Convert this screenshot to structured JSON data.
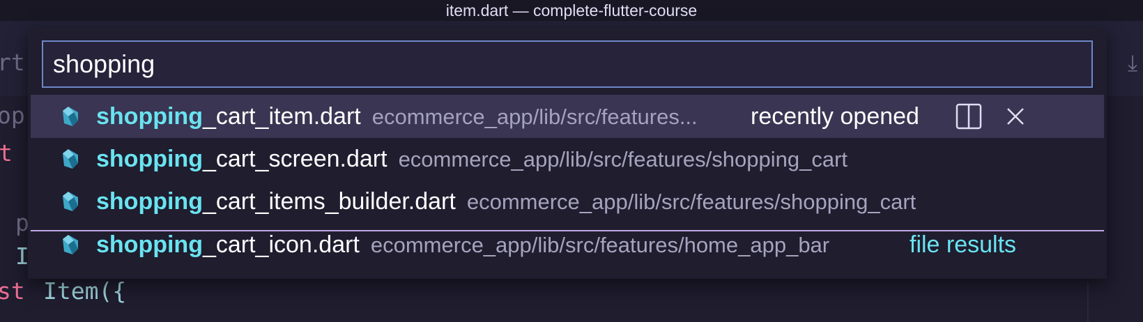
{
  "window": {
    "title": "item.dart — complete-flutter-course"
  },
  "editor_fragments": [
    "rt",
    "op",
    "t",
    "p",
    "I",
    "st",
    "Item({"
  ],
  "quick_open": {
    "search_value": "shopping",
    "rows": [
      {
        "highlight": "shopping",
        "rest": "_cart_item.dart",
        "path": "ecommerce_app/lib/src/features...",
        "tag": "recently opened"
      },
      {
        "highlight": "shopping",
        "rest": "_cart_screen.dart",
        "path": "ecommerce_app/lib/src/features/shopping_cart",
        "tag": ""
      },
      {
        "highlight": "shopping",
        "rest": "_cart_items_builder.dart",
        "path": "ecommerce_app/lib/src/features/shopping_cart",
        "tag": ""
      },
      {
        "highlight": "shopping",
        "rest": "_cart_icon.dart",
        "path": "ecommerce_app/lib/src/features/home_app_bar",
        "tag": "file results"
      }
    ],
    "icons": {
      "file_type": "dart-file-icon",
      "split": "split-editor-icon",
      "remove": "close-icon"
    }
  },
  "colors": {
    "accent_match": "#6ae3f0",
    "selected_row": "#393552",
    "focus_border": "#6f87c7",
    "separator": "#c4a7e7",
    "background": "#1f1d2e"
  }
}
